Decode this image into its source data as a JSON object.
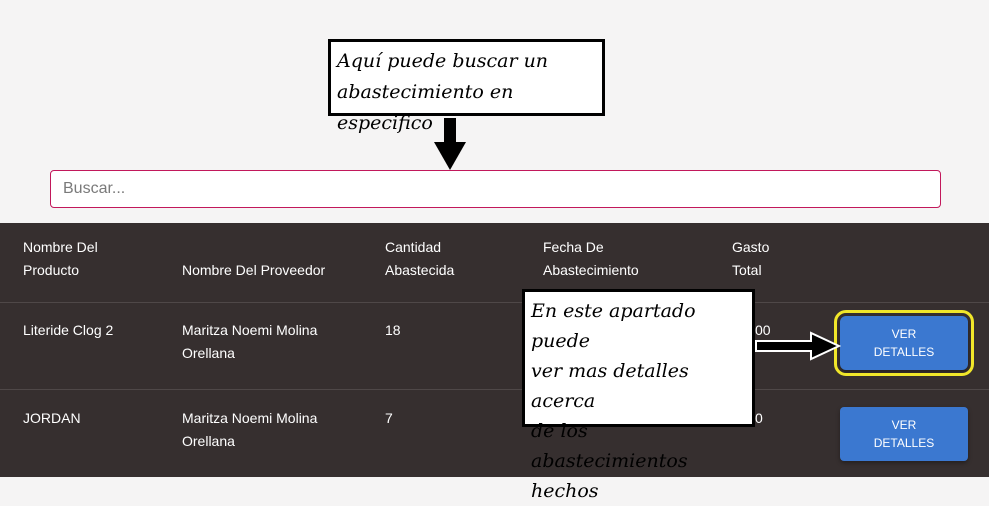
{
  "annotations": {
    "search_tip": [
      "Aquí puede buscar un",
      "abastecimiento en especifico"
    ],
    "details_tip": [
      "En este apartado puede",
      "ver mas detalles acerca",
      "de los abastecimientos",
      "hechos"
    ]
  },
  "search": {
    "placeholder": "Buscar..."
  },
  "table": {
    "headers": [
      [
        "Nombre Del",
        "Producto"
      ],
      [
        "",
        "Nombre Del Proveedor"
      ],
      [
        "Cantidad",
        "Abastecida"
      ],
      [
        "Fecha De",
        "Abastecimiento"
      ],
      [
        "Gasto",
        "Total"
      ]
    ],
    "rows": [
      {
        "product": "Literide Clog 2",
        "provider": [
          "Maritza Noemi Molina",
          "Orellana"
        ],
        "quantity": "18",
        "date": "",
        "total": "00",
        "button": [
          "VER",
          "DETALLES"
        ]
      },
      {
        "product": "JORDAN",
        "provider": [
          "Maritza Noemi Molina",
          "Orellana"
        ],
        "quantity": "7",
        "date": "",
        "total": "0",
        "button": [
          "VER",
          "DETALLES"
        ]
      }
    ]
  },
  "colors": {
    "table_bg": "#362f2f",
    "button": "#3b78d0",
    "search_border": "#c2185b",
    "highlight": "#f0e62a"
  }
}
